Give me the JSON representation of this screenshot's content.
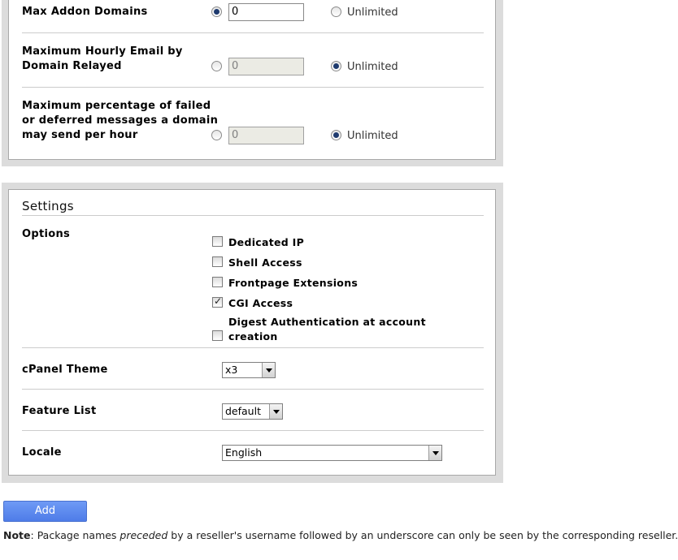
{
  "limits": {
    "max_addon_domains": {
      "label": "Max Addon Domains",
      "value": "0",
      "unlimited_label": "Unlimited"
    },
    "max_hourly_email": {
      "label_line1": "Maximum Hourly Email by",
      "label_line2": "Domain Relayed",
      "value": "0",
      "unlimited_label": "Unlimited"
    },
    "max_failed_pct": {
      "label_line1": "Maximum percentage of failed",
      "label_line2": "or deferred messages a domain",
      "label_line3": "may send per hour",
      "value": "0",
      "unlimited_label": "Unlimited"
    }
  },
  "settings": {
    "heading": "Settings",
    "options_label": "Options",
    "options": [
      {
        "label": "Dedicated IP",
        "checked": false
      },
      {
        "label": "Shell Access",
        "checked": false
      },
      {
        "label": "Frontpage Extensions",
        "checked": false
      },
      {
        "label": "CGI Access",
        "checked": true
      },
      {
        "label_line1": "Digest Authentication at account",
        "label_line2": "creation",
        "checked": false
      }
    ],
    "cpanel_theme": {
      "label": "cPanel Theme",
      "value": "x3"
    },
    "feature_list": {
      "label": "Feature List",
      "value": "default"
    },
    "locale": {
      "label": "Locale",
      "value": "English"
    }
  },
  "add_button": "Add",
  "note": {
    "bold": "Note",
    "part1": ": Package names ",
    "italic": "preceded",
    "part2": " by a reseller's username followed by an underscore can only be seen by the corresponding reseller."
  }
}
